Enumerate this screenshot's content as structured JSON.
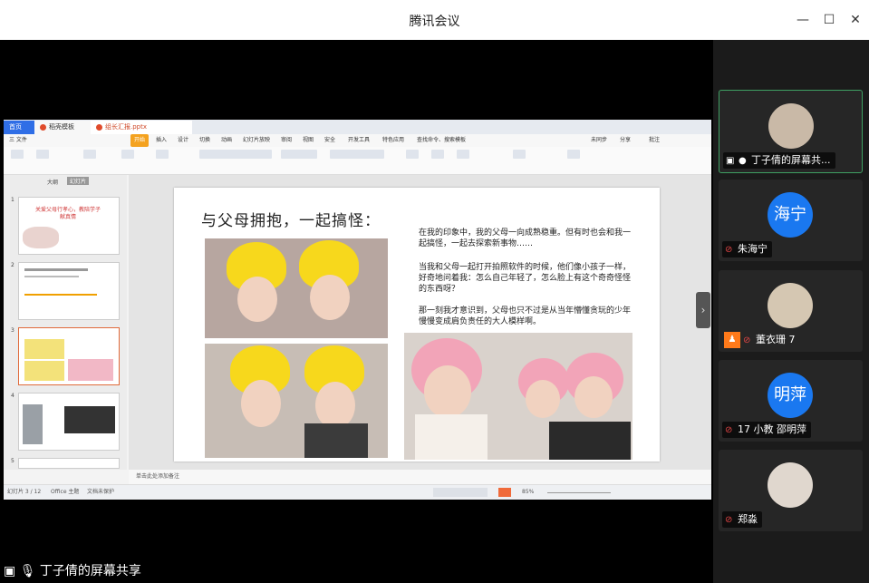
{
  "window": {
    "title": "腾讯会议"
  },
  "share": {
    "label": "丁子倩的屏幕共享"
  },
  "participants": [
    {
      "name": "丁子倩的屏幕共...",
      "avatar_text": "",
      "muted": false
    },
    {
      "name": "朱海宁",
      "avatar_text": "海宁",
      "muted": true
    },
    {
      "name": "董衣珊 7",
      "avatar_text": "",
      "muted": true
    },
    {
      "name": "17 小教 邵明萍",
      "avatar_text": "明萍",
      "muted": true
    },
    {
      "name": "郑淼",
      "avatar_text": "",
      "muted": true
    }
  ],
  "wps": {
    "tabs": {
      "home": "首页",
      "file1": "稻壳模板",
      "file2": "组长汇报.pptx"
    },
    "menu": [
      "三 文件",
      "开始",
      "插入",
      "设计",
      "切换",
      "动画",
      "幻灯片放映",
      "审阅",
      "视图",
      "安全",
      "开发工具",
      "特色应用",
      "查找命令、搜索模板",
      "未同步",
      "分享",
      "批注"
    ],
    "panel_tabs": {
      "outline": "大纲",
      "slides": "幻灯片"
    },
    "thumb_titles": [
      "关爱父母行孝心，教陪学子献真情"
    ],
    "slide": {
      "title": "与父母拥抱，一起搞怪：",
      "para1": "在我的印象中，我的父母一向成熟稳重。但有时也会和我一起搞怪，一起去探索新事物……",
      "para2": "当我和父母一起打开拍照软件的时候，他们像小孩子一样，好奇地问着我：怎么自己年轻了，怎么脸上有这个奇奇怪怪的东西呀？",
      "para3": "那一刻我才意识到，父母也只不过是从当年懵懂贪玩的少年慢慢变成肩负责任的大人模样啊。"
    },
    "notes": "单击此处添加备注",
    "status": {
      "slide_count": "幻灯片 3 / 12",
      "theme": "Office 主题",
      "recovery": "文档未保护",
      "zoom": "85%"
    }
  }
}
